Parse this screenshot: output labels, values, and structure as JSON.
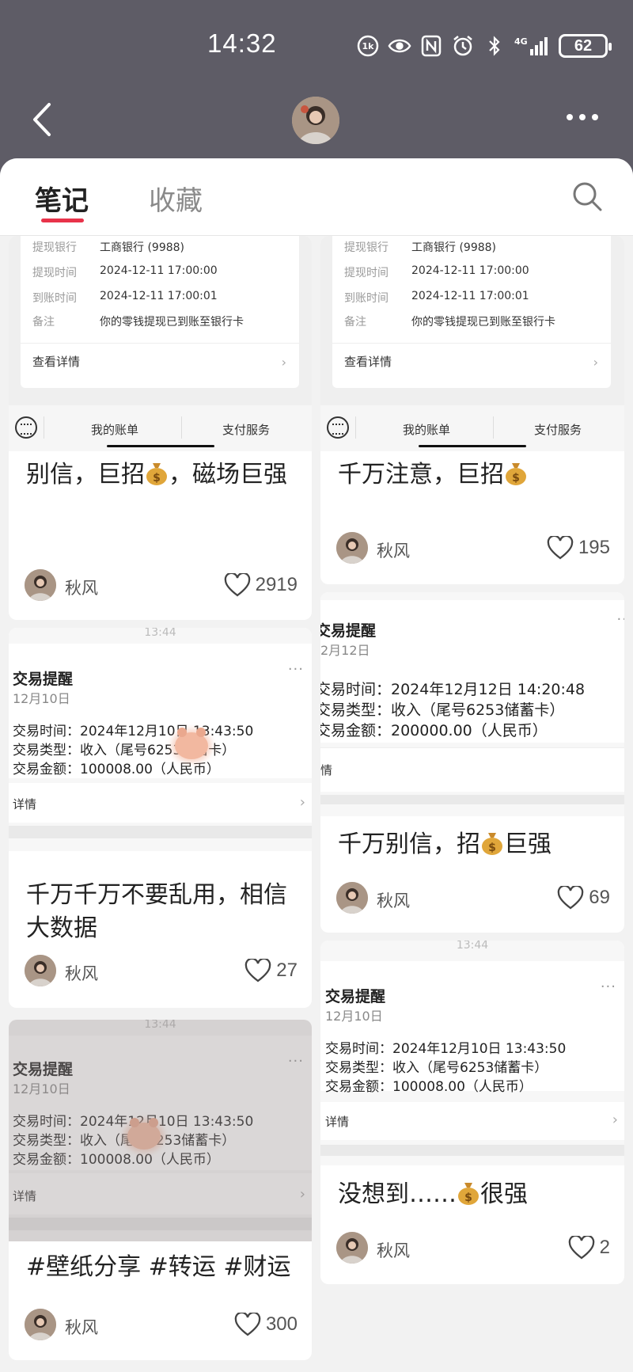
{
  "status_bar": {
    "time": "14:32",
    "battery": "62",
    "icons": [
      "hd-icon",
      "eye-icon",
      "nfc-icon",
      "alarm-icon",
      "bluetooth-icon",
      "signal-4g-icon"
    ],
    "network": "4G"
  },
  "header": {
    "back_icon": "chevron-left-icon",
    "more_icon": "more-dots-icon"
  },
  "tabs": [
    {
      "label": "笔记",
      "active": true
    },
    {
      "label": "收藏",
      "active": false
    }
  ],
  "accent_color": "#e8334a",
  "wallet_cover": {
    "rows": [
      {
        "label": "提现银行",
        "value": "工商银行 (9988)"
      },
      {
        "label": "提现时间",
        "value": "2024-12-11 17:00:00"
      },
      {
        "label": "到账时间",
        "value": "2024-12-11 17:00:01"
      },
      {
        "label": "备注",
        "value": "你的零钱提现已到账至银行卡"
      }
    ],
    "detail": "查看详情",
    "bottom_left": "我的账单",
    "bottom_right": "支付服务"
  },
  "tx_cover": {
    "time": "13:44",
    "title": "交易提醒",
    "detail": "详情"
  },
  "notes": [
    {
      "title_a": "别信，巨招",
      "title_b": "，磁场巨强",
      "author": "秋风",
      "likes": "2919"
    },
    {
      "tx_date": "12月10日",
      "tx_time": "交易时间：2024年12月10日 13:43:50",
      "tx_type": "交易类型：收入（尾号6253储蓄卡）",
      "tx_amount": "交易金额：100008.00（人民币）",
      "title": "千万千万不要乱用，相信大数据",
      "author": "秋风",
      "likes": "27"
    },
    {
      "tx_date": "12月10日",
      "tx_time": "交易时间：2024年12月10日 13:43:50",
      "tx_type": "交易类型：收入（尾号6253储蓄卡）",
      "tx_amount": "交易金额：100008.00（人民币）",
      "title": "#壁纸分享 #转运 #财运",
      "author": "秋风",
      "likes": "300"
    },
    {
      "title_a": "千万注意，巨招",
      "title_b": "",
      "author": "秋风",
      "likes": "195"
    },
    {
      "tx_date": "2月12日",
      "tx_title": "交易提醒",
      "tx_time": "交易时间：2024年12月12日 14:20:48",
      "tx_type": "交易类型：收入（尾号6253储蓄卡）",
      "tx_amount": "交易金额：200000.00（人民币）",
      "tx_detail": "情",
      "title_a": "千万别信，招",
      "title_b": "巨强",
      "author": "秋风",
      "likes": "69"
    },
    {
      "tx_date": "12月10日",
      "tx_time": "交易时间：2024年12月10日 13:43:50",
      "tx_type": "交易类型：收入（尾号6253储蓄卡）",
      "tx_amount": "交易金额：100008.00（人民币）",
      "title_a": "没想到……",
      "title_b": "很强",
      "author": "秋风",
      "likes": "2"
    }
  ]
}
